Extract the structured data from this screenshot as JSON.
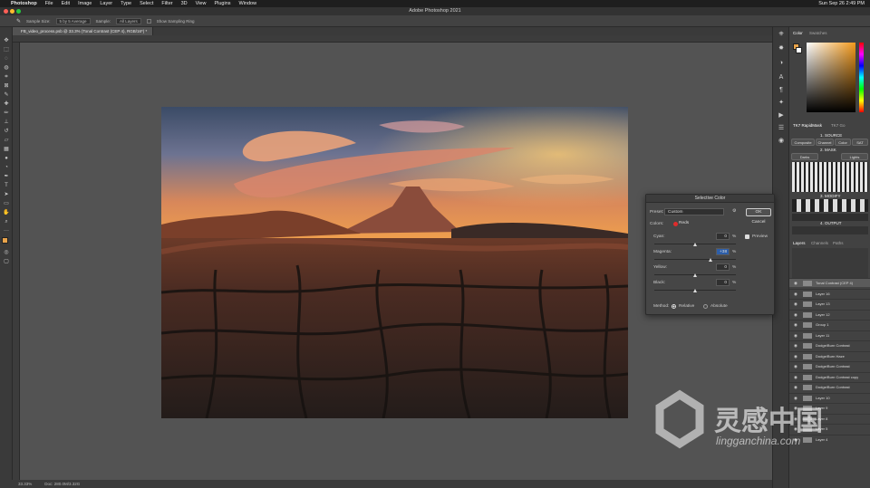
{
  "menubar": {
    "app_name": "Photoshop",
    "items": [
      "File",
      "Edit",
      "Image",
      "Layer",
      "Type",
      "Select",
      "Filter",
      "3D",
      "View",
      "Plugins",
      "Window"
    ],
    "clock": "Sun Sep 26  2:49 PM"
  },
  "window_title": "Adobe Photoshop 2021",
  "options_bar": {
    "sample_size_label": "Sample Size:",
    "sample_size_value": "5 by 5 Average",
    "sample_label": "Sample:",
    "sample_value": "All Layers",
    "show_ring_label": "Show Sampling Ring"
  },
  "document_tab": {
    "title": "FB_video_process.psb @ 33.3% (Tonal Contrast (CEP 4), RGB/16*) *"
  },
  "status_bar": {
    "zoom": "33.33%",
    "doc": "Doc: 280.0M/3.32G"
  },
  "color_panel": {
    "tabs": [
      "Color",
      "Swatches"
    ],
    "foreground": "#e8a34a",
    "background": "#ffffff"
  },
  "tk_panel": {
    "tabs": [
      "TK7 RapidMask",
      "TK7 Go"
    ],
    "source_label": "1. SOURCE",
    "buttons_row1": [
      "Composite",
      "Channel",
      "Color",
      "SAT"
    ],
    "mask_label": "2. MASK",
    "buttons_row2": [
      "Darks",
      "Lights"
    ],
    "modify_label": "3. MODIFY",
    "output_label": "4. OUTPUT"
  },
  "selective_color": {
    "title": "Selective Color",
    "preset_label": "Preset:",
    "preset_value": "Custom",
    "colors_label": "Colors:",
    "colors_value": "Reds",
    "sliders": [
      {
        "label": "Cyan:",
        "value": "0",
        "level": 0.5
      },
      {
        "label": "Magenta:",
        "value": "+38",
        "level": 0.69
      },
      {
        "label": "Yellow:",
        "value": "0",
        "level": 0.5
      },
      {
        "label": "Black:",
        "value": "0",
        "level": 0.5
      }
    ],
    "percent": "%",
    "method_label": "Method:",
    "method_options": [
      "Relative",
      "Absolute"
    ],
    "method_selected": "Relative",
    "ok_label": "OK",
    "cancel_label": "Cancel",
    "preview_label": "Preview"
  },
  "layers_panel": {
    "tabs": [
      "Layers",
      "Channels",
      "Paths"
    ],
    "layers": [
      {
        "name": "Tonal Contrast (CEP 4)",
        "selected": true
      },
      {
        "name": "Layer 16"
      },
      {
        "name": "Layer 13"
      },
      {
        "name": "Layer 12"
      },
      {
        "name": "Group 1"
      },
      {
        "name": "Layer 11"
      },
      {
        "name": "Dodge/Burn Contrast"
      },
      {
        "name": "Dodge/Burn Haze"
      },
      {
        "name": "Dodge/Burn Contrast"
      },
      {
        "name": "Dodge/Burn Contrast copy"
      },
      {
        "name": "Dodge/Burn Contrast"
      },
      {
        "name": "Layer 10"
      },
      {
        "name": "Layer 9"
      },
      {
        "name": "Layer 8"
      },
      {
        "name": "Layer 5"
      },
      {
        "name": "Layer 4"
      }
    ]
  },
  "watermark": {
    "cn": "灵感中国",
    "url": "lingganchina.com"
  }
}
